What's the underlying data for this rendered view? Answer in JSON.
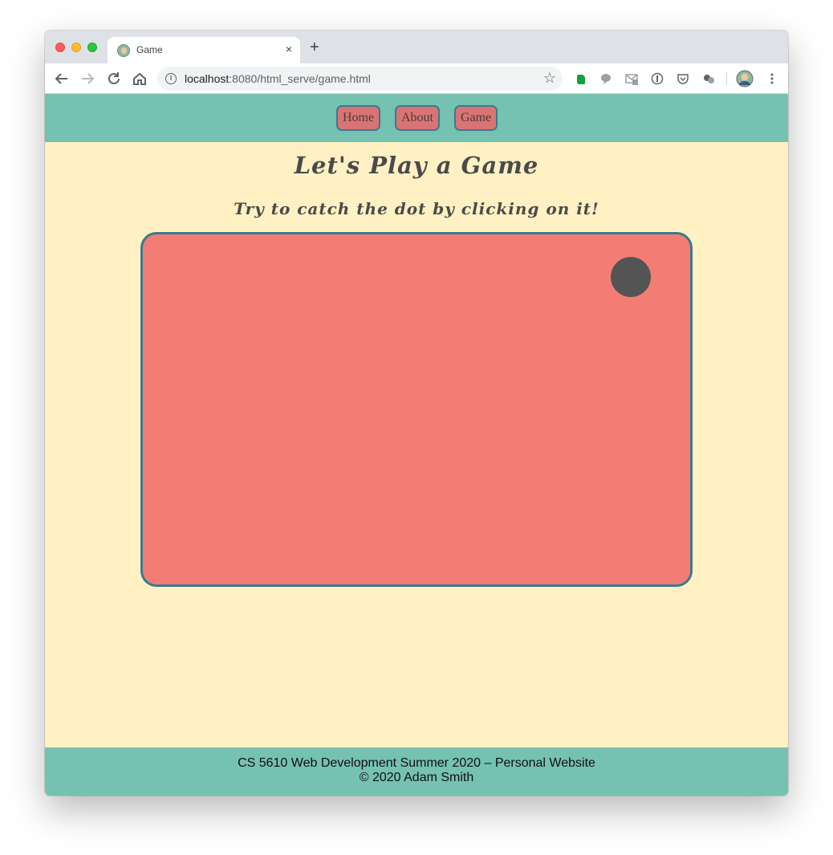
{
  "browser": {
    "tab_title": "Game",
    "tab_close": "×",
    "new_tab": "+",
    "url_host": "localhost",
    "url_rest": ":8080/html_serve/game.html"
  },
  "nav": {
    "items": [
      {
        "label": "Home"
      },
      {
        "label": "About"
      },
      {
        "label": "Game"
      }
    ]
  },
  "main": {
    "title": "Let's Play a Game",
    "subtitle": "Try to catch the dot by clicking on it!"
  },
  "footer": {
    "line1": "CS 5610 Web Development Summer 2020 – Personal Website",
    "line2": "© 2020 Adam Smith"
  },
  "colors": {
    "navbar": "#75c1b2",
    "page_bg": "#fff1c3",
    "board": "#f37d74",
    "board_border": "#3b7a8f",
    "dot": "#545454",
    "nav_button": "#da7474"
  },
  "icons": [
    "back-arrow-icon",
    "forward-arrow-icon",
    "reload-icon",
    "home-icon",
    "info-icon",
    "star-icon",
    "evernote-icon",
    "speech-bubble-icon",
    "gmail-icon",
    "onepassword-icon",
    "pocket-icon",
    "extensions-icon",
    "profile-avatar-icon",
    "menu-kebab-icon"
  ]
}
